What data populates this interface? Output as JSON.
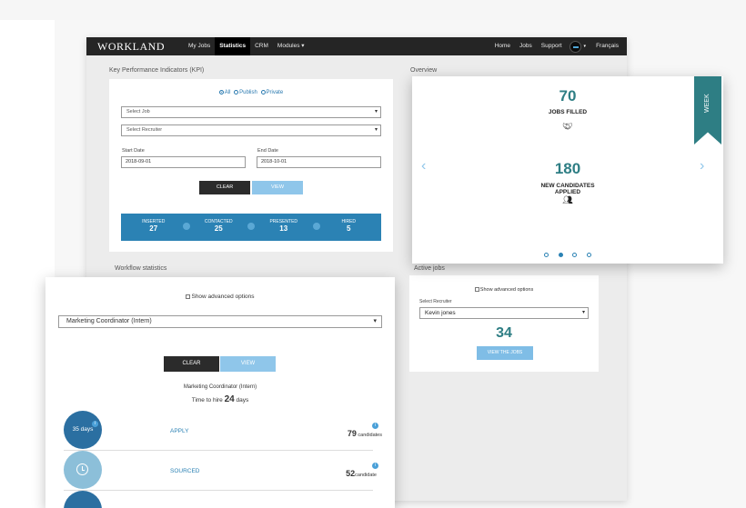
{
  "nav": {
    "logo": "WORKLAND",
    "items": [
      "My Jobs",
      "Statistics",
      "CRM",
      "Modules ▾"
    ],
    "right_items": [
      "Home",
      "Jobs",
      "Support"
    ],
    "language": "Français"
  },
  "kpi": {
    "title": "Key Performance Indicators (KPI)",
    "radio_all": "All",
    "radio_publish": "Publish",
    "radio_private": "Private",
    "select_job": "Select Job",
    "select_recruiter": "Select Recruiter",
    "start_label": "Start Date",
    "end_label": "End Date",
    "start_value": "2018-09-01",
    "end_value": "2018-10-01",
    "clear": "CLEAR",
    "view": "VIEW",
    "stats": [
      {
        "label": "INSERTED",
        "value": "27"
      },
      {
        "label": "CONTACTED",
        "value": "25"
      },
      {
        "label": "PRESENTED",
        "value": "13"
      },
      {
        "label": "HIRED",
        "value": "5"
      }
    ]
  },
  "overview": {
    "title": "Overview",
    "ribbon": "WEEK",
    "metric1_value": "70",
    "metric1_label": "JOBS FILLED",
    "metric2_value": "180",
    "metric2_label_1": "NEW CANDIDATES",
    "metric2_label_2": "APPLIED"
  },
  "active_jobs": {
    "title": "Active jobs",
    "advanced": "Show advanced options",
    "recruiter_label": "Select Recruiter",
    "recruiter_value": "Kevin jones",
    "count": "34",
    "button": "VIEW THE JOBS"
  },
  "workflow": {
    "title": "Workflow statistics",
    "advanced": "Show advanced options",
    "job_value": "Marketing Coordinator (Intern)",
    "clear": "CLEAR",
    "view": "VIEW",
    "job_heading": "Marketing Coordinator (Intern)",
    "time_prefix": "Time to hire",
    "time_value": "24",
    "time_suffix": "days",
    "steps": [
      {
        "circle": "35 days",
        "name": "APPLY",
        "count": "79",
        "unit": "candidates"
      },
      {
        "circle": "",
        "name": "SOURCED",
        "count": "52",
        "unit": "candidate"
      }
    ]
  }
}
